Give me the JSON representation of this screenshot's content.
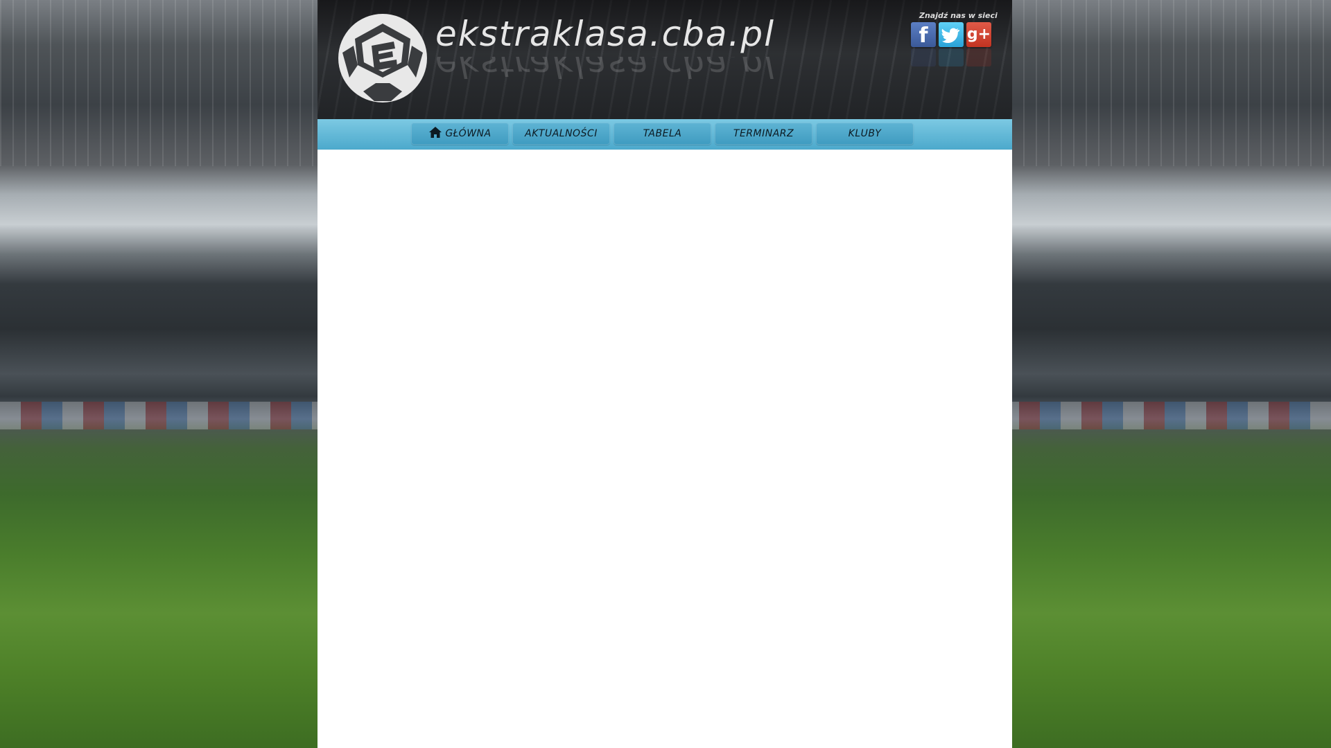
{
  "header": {
    "site_title": "ekstraklasa.cba.pl",
    "social_caption": "Znajdź nas w sieci",
    "social": [
      {
        "icon": "facebook-icon",
        "glyph": "f",
        "color": "#3b5998"
      },
      {
        "icon": "twitter-icon",
        "glyph": "t",
        "color": "#2aa3d8"
      },
      {
        "icon": "google-plus-icon",
        "glyph": "g+",
        "color": "#c23321"
      }
    ]
  },
  "nav": {
    "items": [
      {
        "label": "GŁÓWNA",
        "icon": "home-icon"
      },
      {
        "label": "AKTUALNOŚCI"
      },
      {
        "label": "TABELA"
      },
      {
        "label": "TERMINARZ"
      },
      {
        "label": "KLUBY"
      }
    ]
  },
  "colors": {
    "nav_bar": "#5ab4d6",
    "nav_button": "#4aa6c9",
    "header_dark": "#2b2d30",
    "content_bg": "#ffffff"
  }
}
